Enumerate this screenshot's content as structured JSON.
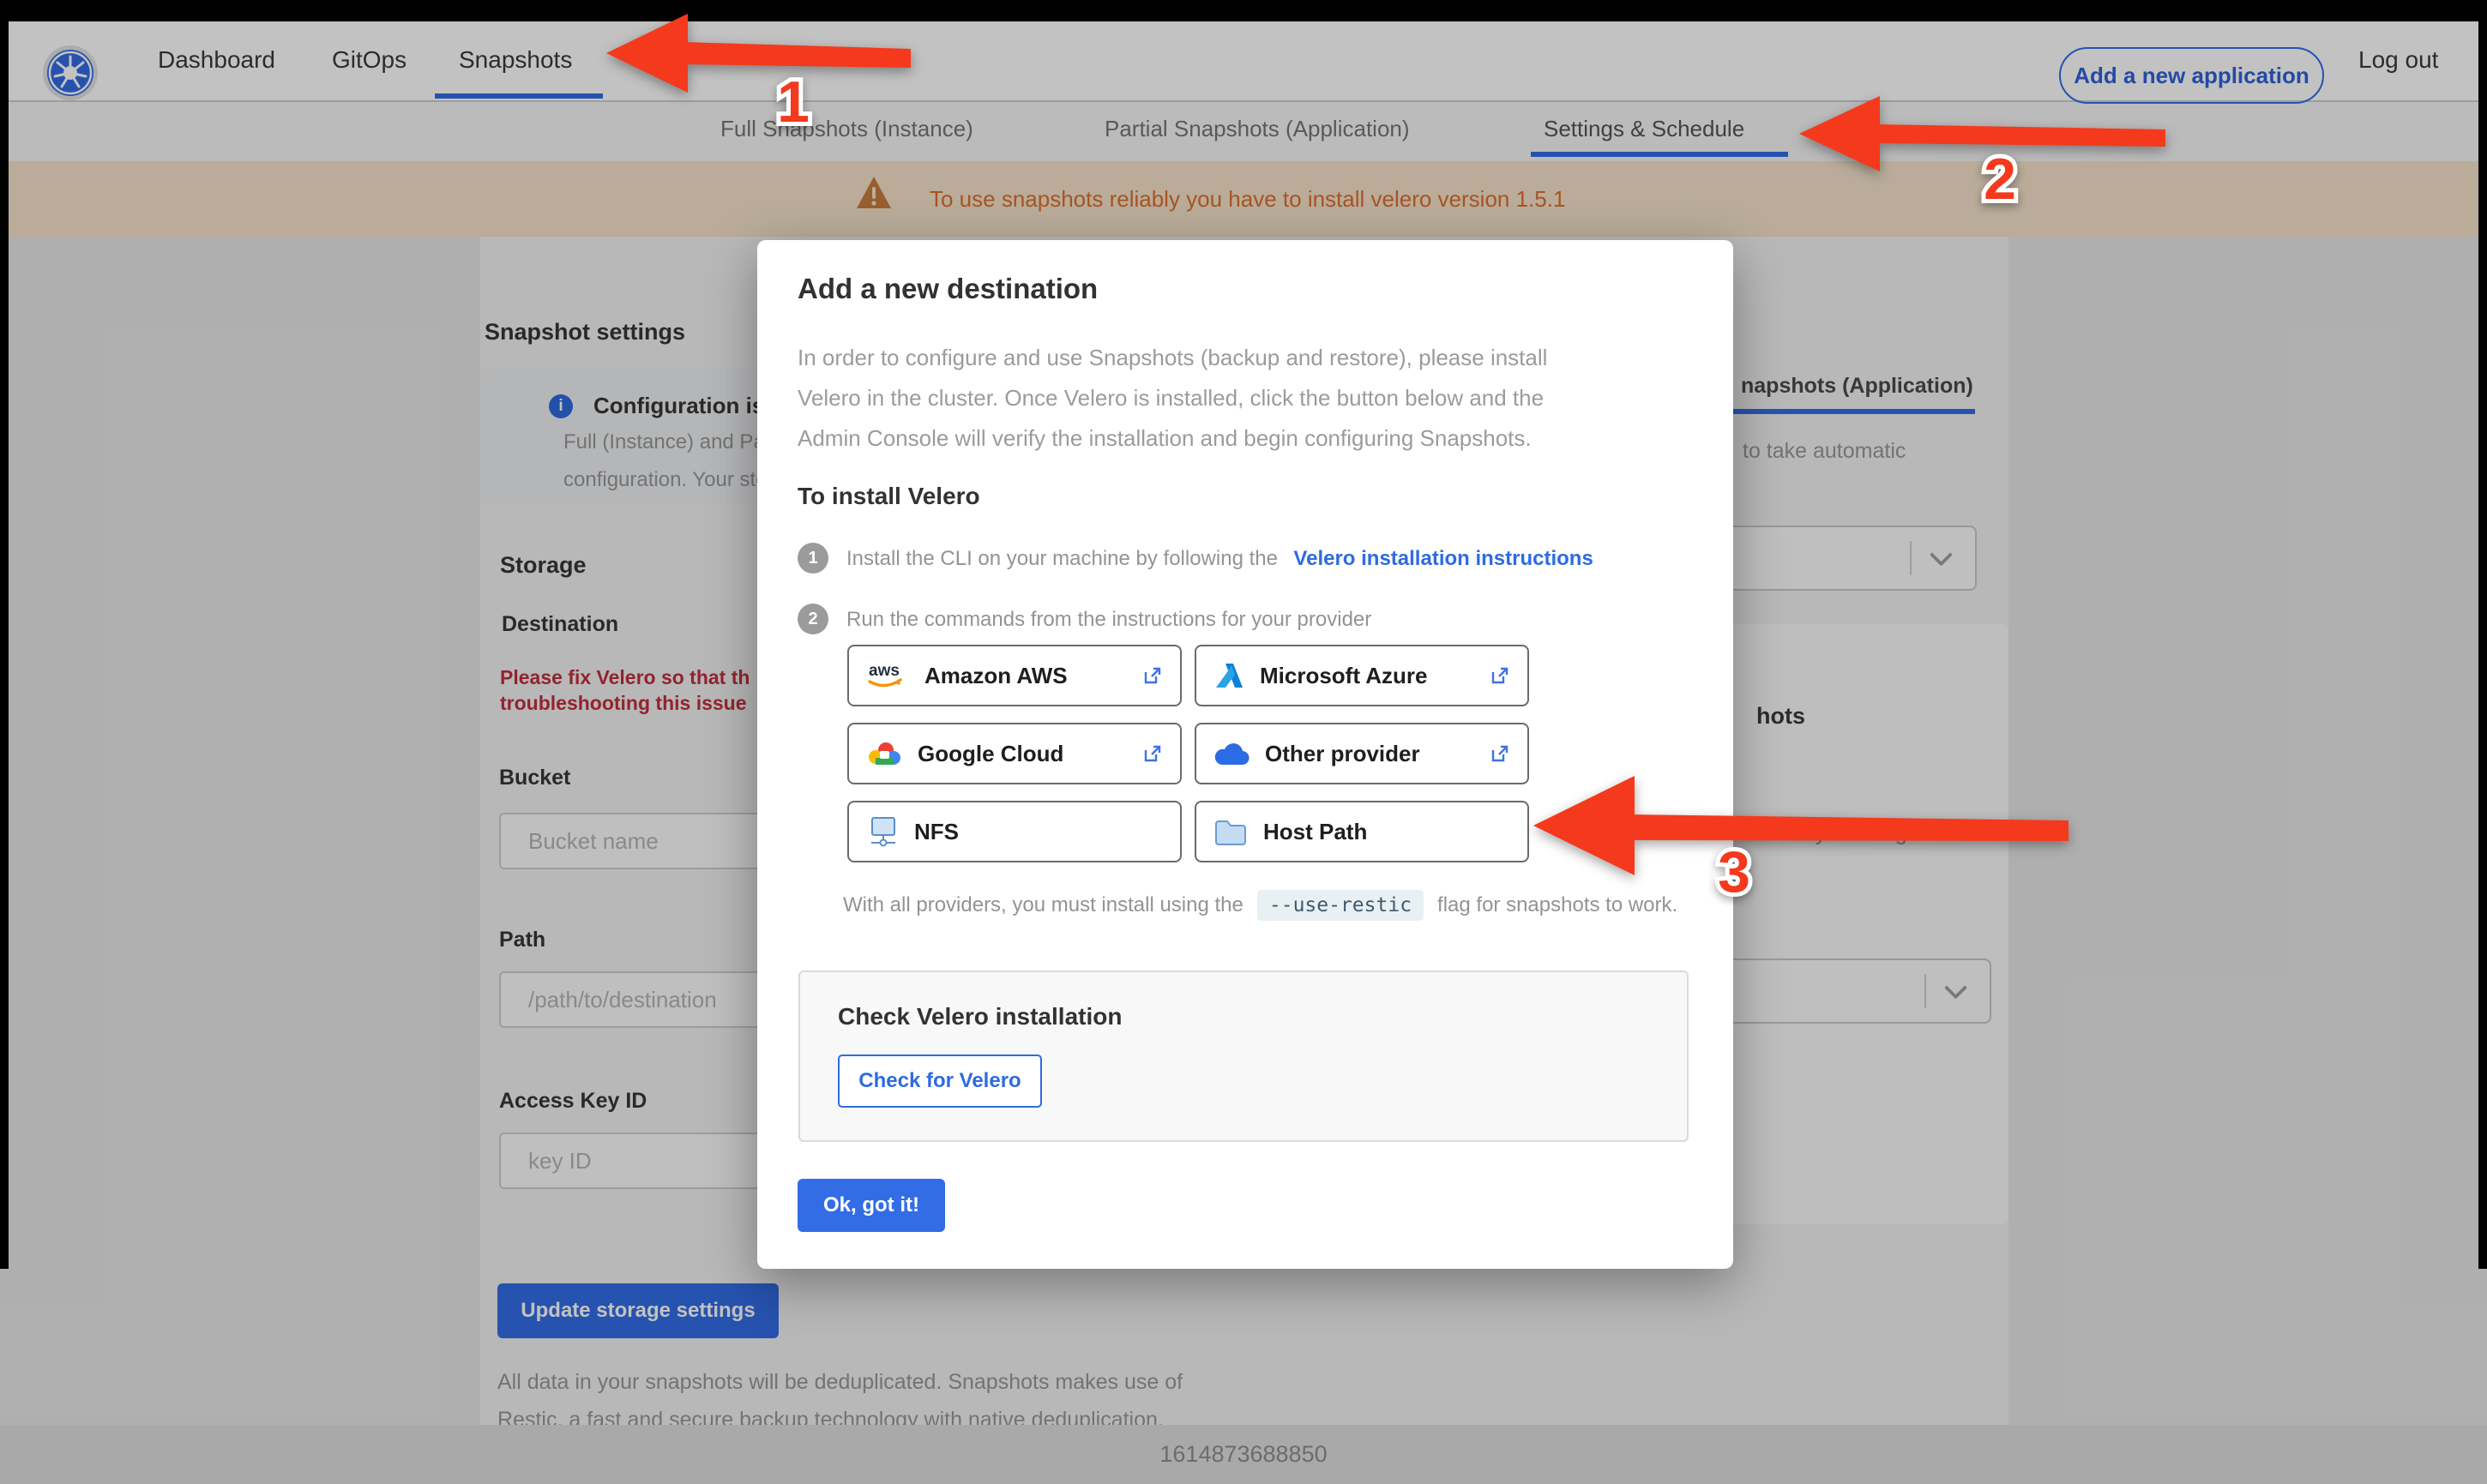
{
  "navbar": {
    "items": [
      {
        "label": "Dashboard",
        "active": false
      },
      {
        "label": "GitOps",
        "active": false
      },
      {
        "label": "Snapshots",
        "active": true
      }
    ],
    "add_app_label": "Add a new application",
    "logout_label": "Log out"
  },
  "tabbar": {
    "tabs": [
      {
        "label": "Full Snapshots (Instance)",
        "active": false
      },
      {
        "label": "Partial Snapshots (Application)",
        "active": false
      },
      {
        "label": "Settings & Schedule",
        "active": true
      }
    ]
  },
  "banner": {
    "text": "To use snapshots reliably you have to install velero version 1.5.1"
  },
  "settings_page": {
    "title": "Snapshot settings",
    "info_box": {
      "title": "Configuration is sh",
      "line1": "Full (Instance) and Parti",
      "line2": "configuration. Your stor"
    },
    "storage_heading": "Storage",
    "destination_label": "Destination",
    "error_line1": "Please fix Velero so that th",
    "error_line2": "troubleshooting this issue",
    "bucket_label": "Bucket",
    "bucket_placeholder": "Bucket name",
    "path_label": "Path",
    "path_placeholder": "/path/to/destination",
    "access_key_label": "Access Key ID",
    "access_key_placeholder": "key ID",
    "update_button": "Update storage settings",
    "footnote_line1": "All data in your snapshots will be deduplicated. Snapshots makes use of",
    "footnote_line2": "Restic, a fast and secure backup technology with native deduplication."
  },
  "schedule_panel": {
    "tab_fragment": "napshots (Application)",
    "auto_text_fragment": "to take automatic",
    "heading_fragment": "hots",
    "delete_text_fragment": "matically deleting older"
  },
  "modal": {
    "title": "Add a new destination",
    "body_line1": "In order to configure and use Snapshots (backup and restore), please install",
    "body_line2": "Velero in the cluster. Once Velero is installed, click the button below and the",
    "body_line3": "Admin Console will verify the installation and begin configuring Snapshots.",
    "install_heading": "To install Velero",
    "step1_num": "1",
    "step1_text": "Install the CLI on your machine by following the",
    "step1_link": "Velero installation instructions",
    "step2_num": "2",
    "step2_text": "Run the commands from the instructions for your provider",
    "providers": [
      {
        "label": "Amazon AWS"
      },
      {
        "label": "Microsoft Azure"
      },
      {
        "label": "Google Cloud"
      },
      {
        "label": "Other provider"
      },
      {
        "label": "NFS"
      },
      {
        "label": "Host Path"
      }
    ],
    "restic_before": "With all providers, you must install using the",
    "restic_code": "--use-restic",
    "restic_after": "flag for snapshots to work.",
    "check_heading": "Check Velero installation",
    "check_button": "Check for Velero",
    "ok_button": "Ok, got it!"
  },
  "annotations": {
    "label1": "1",
    "label2": "2",
    "label3": "3"
  },
  "footer": {
    "timestamp": "1614873688850"
  },
  "colors": {
    "accent_blue": "#326de6",
    "k8s_blue": "#326ce5",
    "arrow_red": "#f5391c",
    "banner_text_orange": "#dd6f2e",
    "error_red": "#c22f3f",
    "link_blue": "#2f6be0"
  }
}
